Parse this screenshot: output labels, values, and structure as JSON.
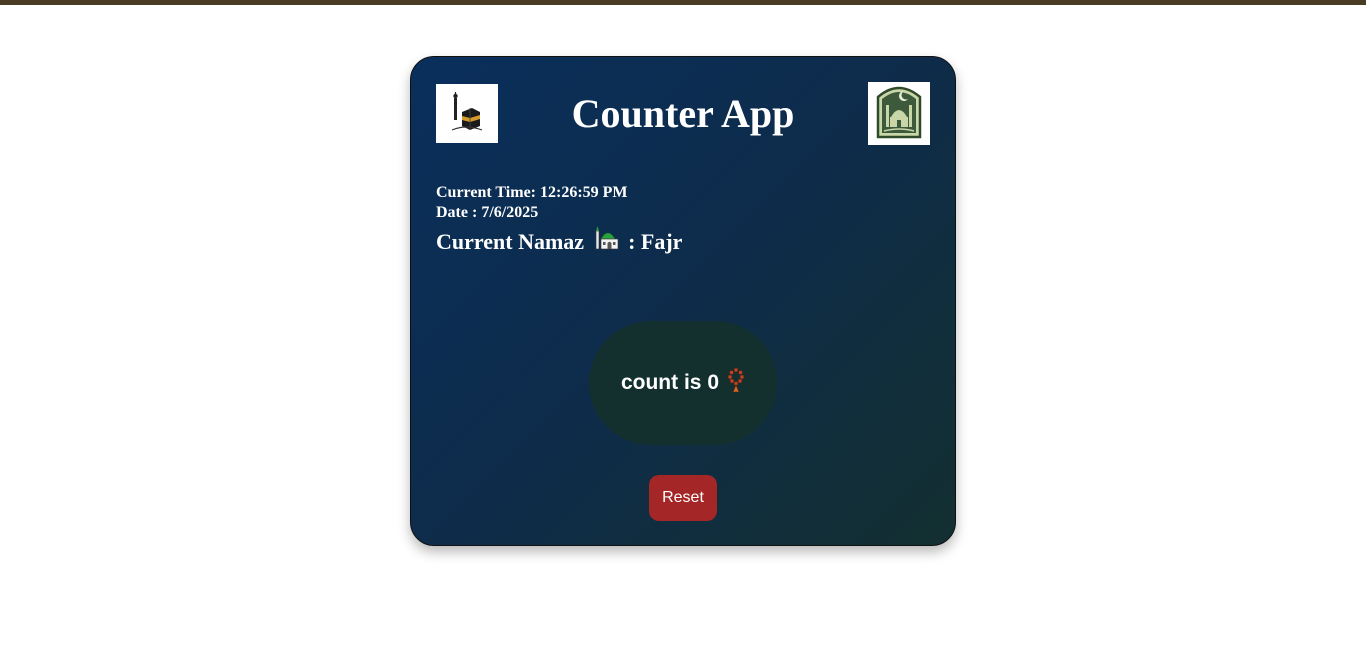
{
  "app": {
    "title": "Counter App"
  },
  "clock": {
    "time_label": "Current Time:",
    "time_value": "12:26:59 PM",
    "date_label": "Date :",
    "date_value": "7/6/2025"
  },
  "namaz": {
    "label": "Current Namaz",
    "separator": ":",
    "value": "Fajr"
  },
  "counter": {
    "prefix": "count is",
    "count": "0"
  },
  "controls": {
    "reset_label": "Reset"
  },
  "icons": {
    "left_logo": "kaaba-icon",
    "right_logo": "mosque-badge-icon",
    "namaz_icon": "mosque-icon",
    "counter_icon": "prayer-beads-icon"
  },
  "colors": {
    "topbar": "#4a3b24",
    "card_start": "#0a2f5c",
    "card_end": "#132f30",
    "counter_bg": "#13302f",
    "reset_bg": "#a52626"
  }
}
